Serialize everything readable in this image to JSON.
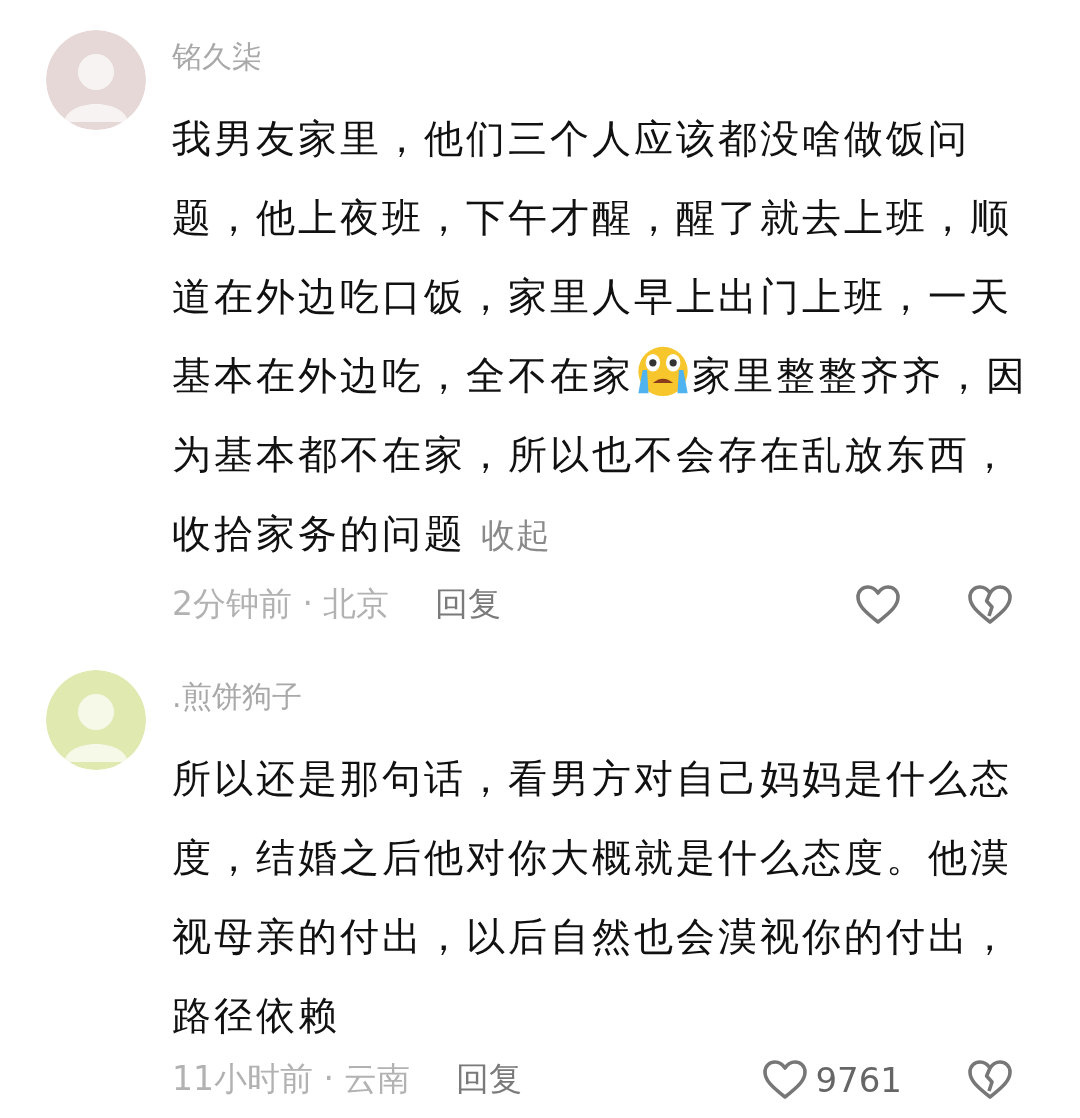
{
  "comments": [
    {
      "author": "铭久柒",
      "avatar": {
        "color": "#e6d8d6"
      },
      "body": [
        {
          "kind": "text",
          "text": "我男友家里，他们三个人应该都没啥做饭问题，他上夜班，下午才醒，醒了就去上班，顺道在外边吃口饭，家里人早上出门上班，一天基本在外边吃，全不在家"
        },
        {
          "kind": "emoji"
        },
        {
          "kind": "text",
          "text": "家里整整齐齐，因为基本都不在家，所以也不会存在乱放东西，收拾家务的问题"
        }
      ],
      "collapse_link": "收起",
      "time_location": "2分钟前 · 北京",
      "reply": "回复"
    },
    {
      "author": ".煎饼狗子",
      "avatar": {
        "color": "#dfe9b0"
      },
      "body": [
        {
          "kind": "text",
          "text": "所以还是那句话，看男方对自己妈妈是什么态度，结婚之后他对你大概就是什么态度。他漠视母亲的付出，以后自然也会漠视你的付出，路径依赖"
        }
      ],
      "time_location": "11小时前 · 云南",
      "reply": "回复",
      "like_count": "9761"
    }
  ]
}
